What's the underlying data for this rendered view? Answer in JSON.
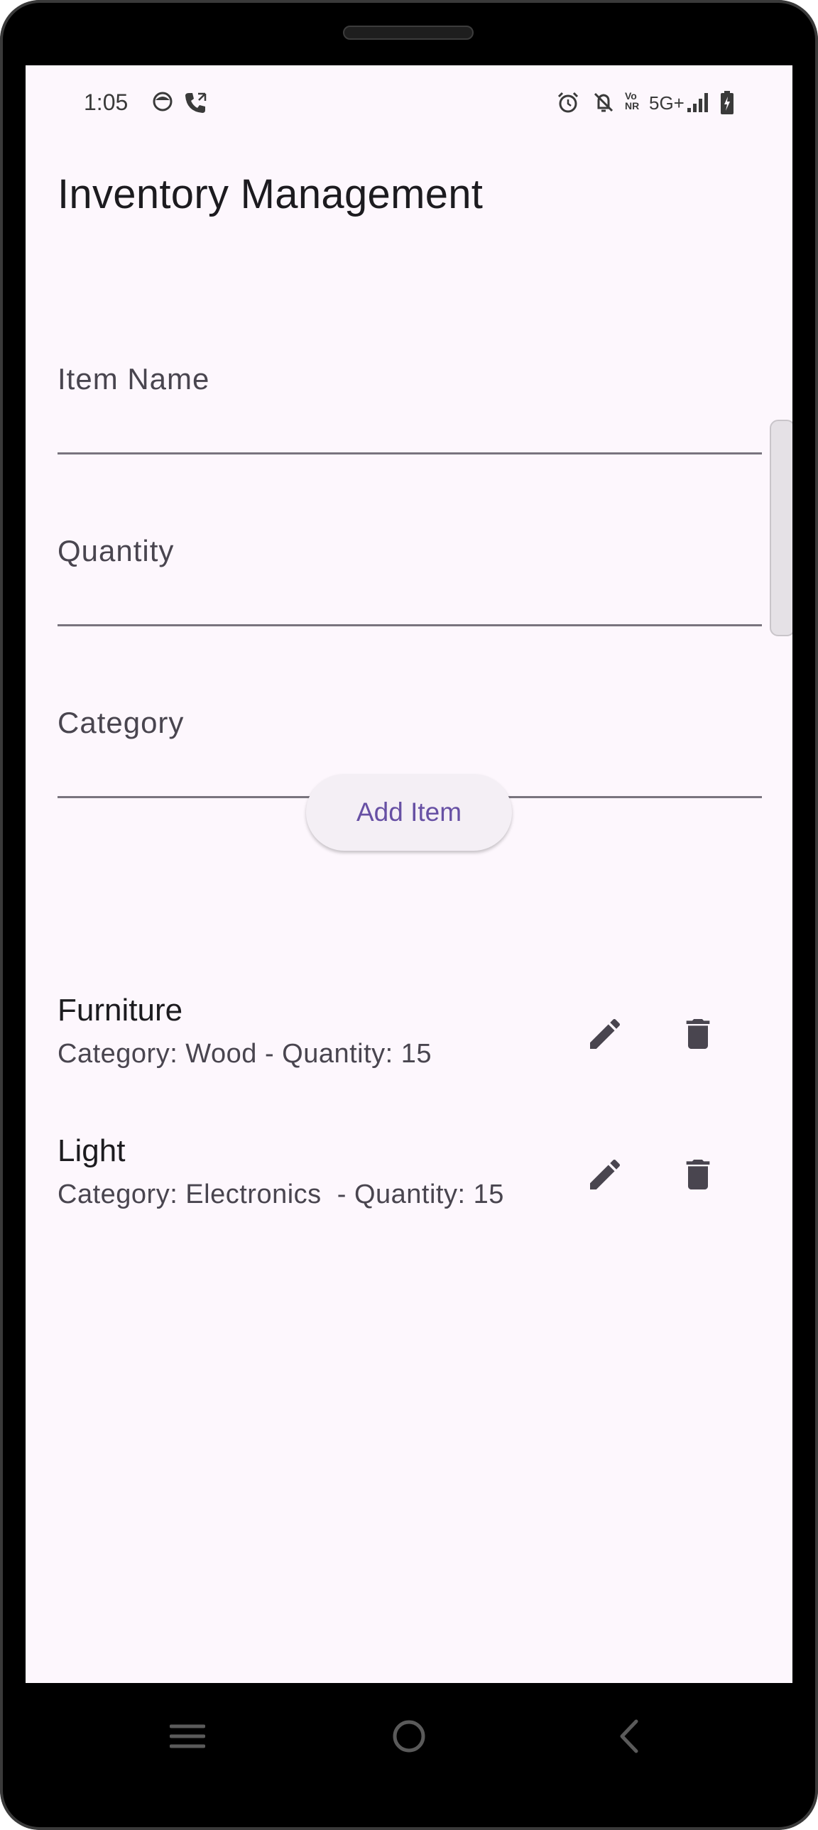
{
  "status_bar": {
    "time": "1:05",
    "left_icons": [
      "face-icon",
      "call-icon"
    ],
    "right_icons": [
      "alarm-icon",
      "bell-off-icon",
      "volte-icon",
      "5g-icon",
      "signal-icon",
      "battery-icon"
    ],
    "network_vo": "Vo",
    "network_nr": "NR",
    "network_label": "5G+"
  },
  "app_bar": {
    "title": "Inventory Management"
  },
  "form": {
    "item_name_label": "Item Name",
    "quantity_label": "Quantity",
    "category_label": "Category",
    "item_name_value": "",
    "quantity_value": "",
    "category_value": "",
    "add_button_label": "Add Item"
  },
  "items": [
    {
      "name": "Furniture",
      "subtitle": "Category: Wood - Quantity: 15",
      "edit_icon": "edit-icon",
      "delete_icon": "delete-icon"
    },
    {
      "name": "Light",
      "subtitle": "Category: Electronics  - Quantity: 15",
      "edit_icon": "edit-icon",
      "delete_icon": "delete-icon"
    }
  ],
  "nav_bar": {
    "icons": [
      "recents-icon",
      "home-icon",
      "back-icon"
    ]
  },
  "colors": {
    "background": "#fdf7fd",
    "accent": "#6750a4",
    "text_primary": "#1c1b1f",
    "text_secondary": "#49454f",
    "icon": "#49454f"
  }
}
